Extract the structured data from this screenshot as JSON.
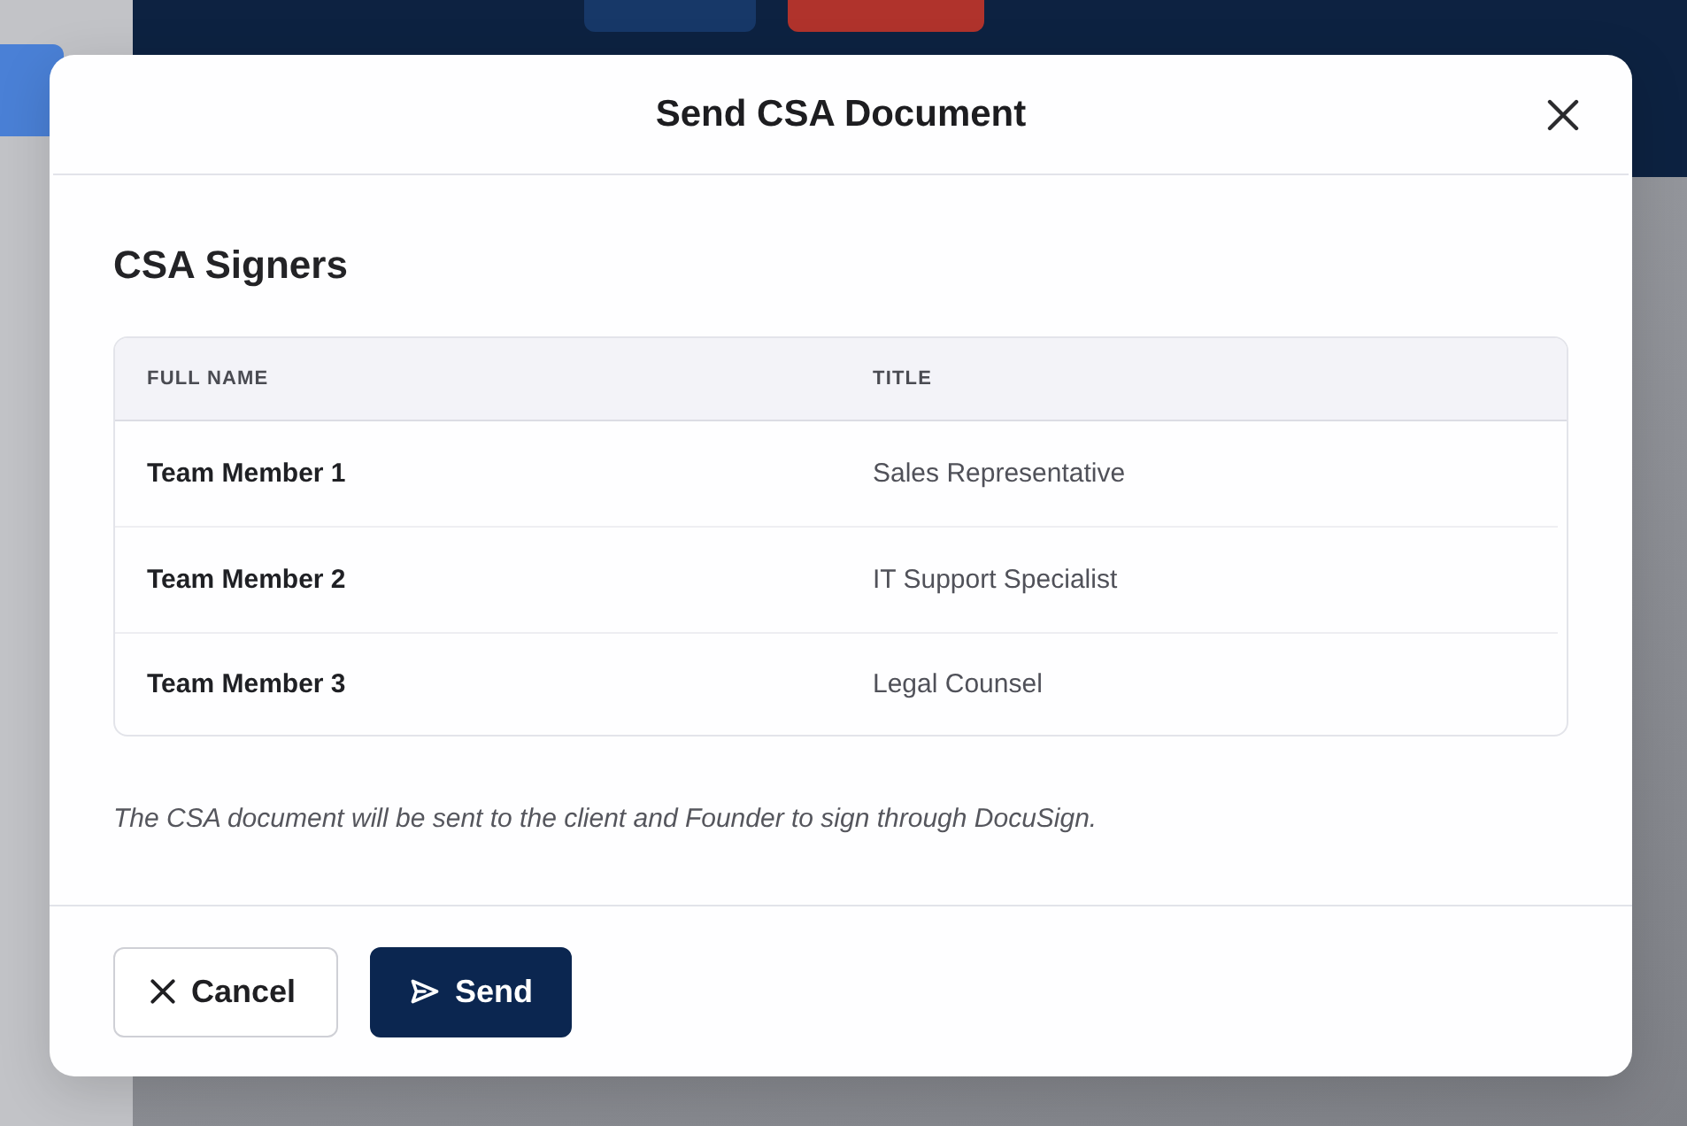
{
  "dialog": {
    "title": "Send CSA Document",
    "section_title": "CSA Signers",
    "table": {
      "columns": [
        "FULL NAME",
        "TITLE"
      ],
      "rows": [
        {
          "full_name": "Team Member 1",
          "title": "Sales Representative"
        },
        {
          "full_name": "Team Member 2",
          "title": "IT Support Specialist"
        },
        {
          "full_name": "Team Member 3",
          "title": "Legal Counsel"
        }
      ]
    },
    "note": "The CSA document will be sent to the client and Founder to sign through DocuSign.",
    "buttons": [
      {
        "kind": "secondary",
        "label": "Cancel"
      },
      {
        "kind": "primary",
        "label": "Send"
      }
    ]
  }
}
